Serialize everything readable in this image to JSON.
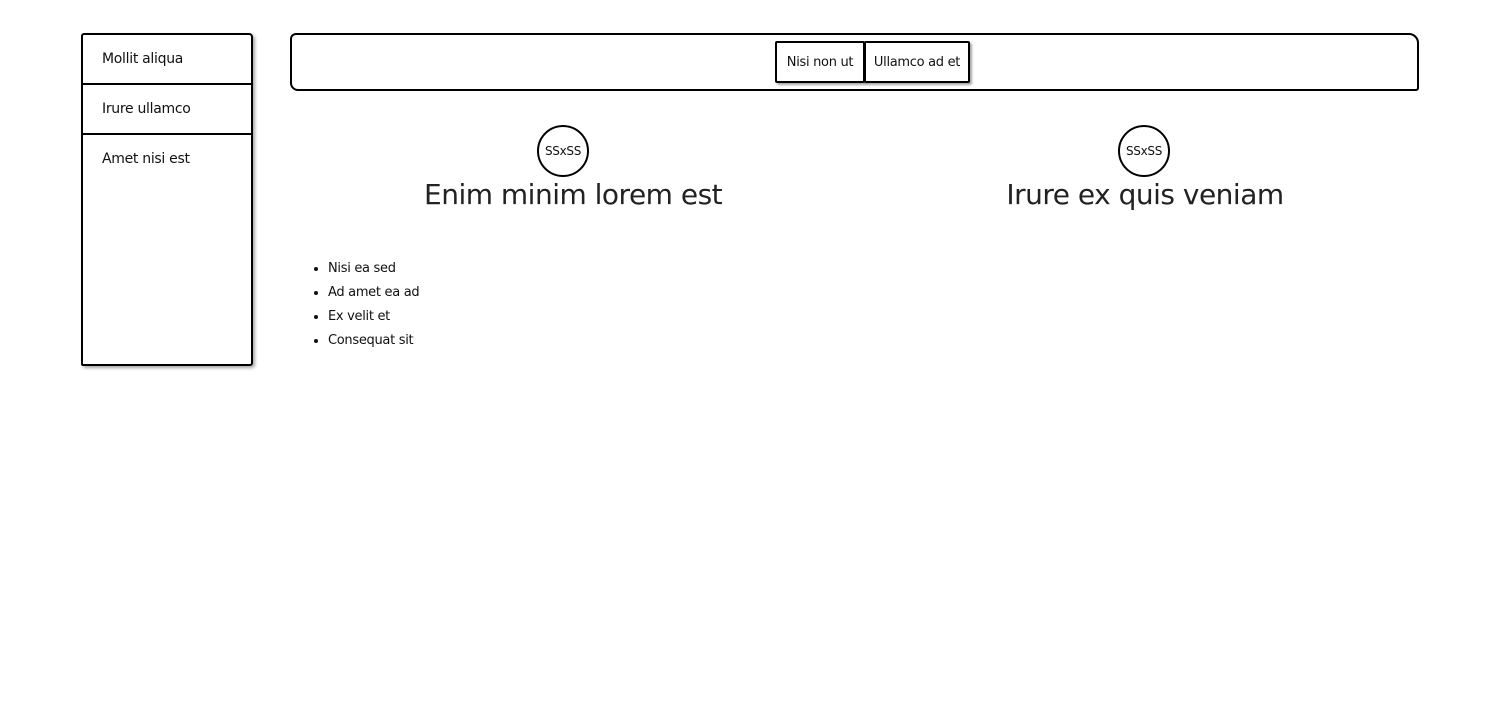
{
  "sidebar": {
    "items": [
      {
        "label": "Mollit aliqua"
      },
      {
        "label": "Irure ullamco"
      },
      {
        "label": "Amet nisi est"
      }
    ]
  },
  "topbar": {
    "buttons": [
      {
        "label": "Nisi non ut"
      },
      {
        "label": "Ullamco ad et"
      }
    ]
  },
  "columns": [
    {
      "avatar": "SSxSS",
      "heading": "Enim minim lorem est"
    },
    {
      "avatar": "SSxSS",
      "heading": "Irure ex quis veniam"
    }
  ],
  "list": {
    "items": [
      "Nisi ea sed",
      "Ad amet ea ad",
      "Ex velit et",
      "Consequat sit"
    ]
  }
}
